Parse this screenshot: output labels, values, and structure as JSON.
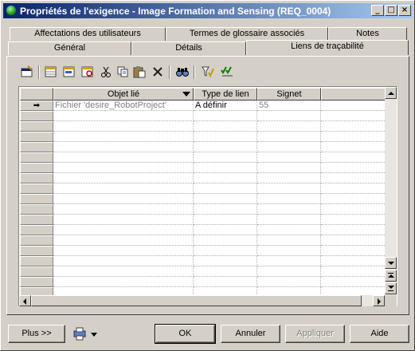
{
  "window": {
    "title": "Propriétés de l'exigence - Image Formation and Sensing (REQ_0004)",
    "minimize": "_",
    "maximize": "□",
    "close": "×"
  },
  "tabs_top": [
    {
      "label": "Affectations des utilisateurs"
    },
    {
      "label": "Termes de glossaire associés"
    },
    {
      "label": "Notes"
    }
  ],
  "tabs_bottom": [
    {
      "label": "Général"
    },
    {
      "label": "Détails"
    },
    {
      "label": "Liens de traçabilité",
      "active": true
    }
  ],
  "toolbar": {
    "icons": [
      "properties-icon",
      "add-rows-icon",
      "insert-row-icon",
      "add-objects-icon",
      "cut-icon",
      "copy-icon",
      "paste-icon",
      "delete-icon",
      "find-icon",
      "filter-icon",
      "customize-columns-icon"
    ]
  },
  "grid": {
    "columns": [
      "Objet lié",
      "Type de lien",
      "Signet"
    ],
    "rows": [
      {
        "marker": "➡",
        "linked_object": "Fichier 'desire_RobotProject'",
        "link_type": "A définir",
        "bookmark": "55"
      }
    ]
  },
  "buttons": {
    "more": "Plus >>",
    "ok": "OK",
    "cancel": "Annuler",
    "apply": "Appliquer",
    "help": "Aide"
  }
}
